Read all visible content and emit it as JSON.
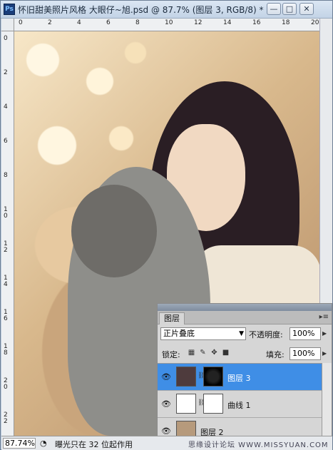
{
  "window": {
    "title": "怀旧甜美照片风格 大眼仔~旭.psd @ 87.7% (图层 3, RGB/8) *",
    "app_icon": "Ps",
    "min_label": "—",
    "max_label": "□",
    "close_label": "✕"
  },
  "ruler_top": [
    "0",
    "2",
    "4",
    "6",
    "8",
    "10",
    "12",
    "14",
    "16",
    "18",
    "20"
  ],
  "ruler_left": [
    "0",
    "2",
    "4",
    "6",
    "8",
    "10",
    "12",
    "14",
    "16",
    "18",
    "20",
    "22"
  ],
  "panel": {
    "tab": "图层",
    "menu_icon": "▸≡",
    "blend_mode": "正片叠底",
    "opacity_label": "不透明度:",
    "opacity_value": "100%",
    "lock_label": "锁定:",
    "fill_label": "填充:",
    "fill_value": "100%",
    "layers": [
      {
        "name": "图层 3",
        "selected": true
      },
      {
        "name": "曲线 1",
        "selected": false
      },
      {
        "name": "图层 2",
        "selected": false
      }
    ]
  },
  "status": {
    "zoom": "87.74%",
    "text": "曝光只在 32 位起作用",
    "watermark": "思缘设计论坛 WWW.MISSYUAN.COM"
  }
}
